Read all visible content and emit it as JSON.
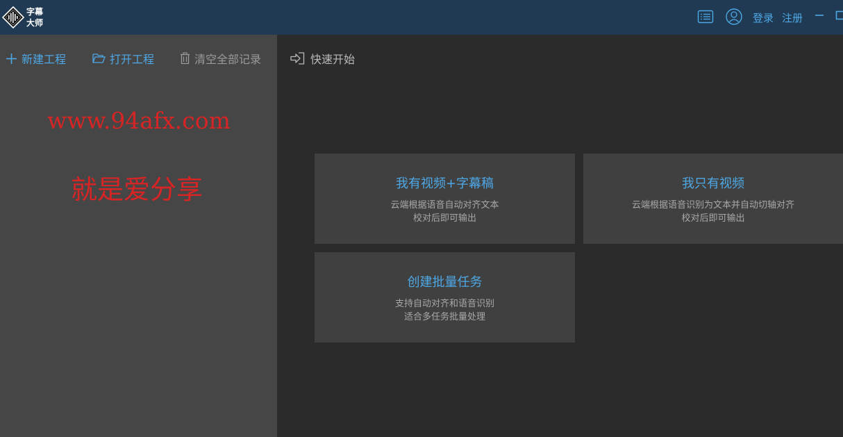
{
  "titlebar": {
    "logo_line1": "字幕",
    "logo_line2": "大师",
    "login_label": "登录",
    "register_label": "注册"
  },
  "sidebar": {
    "new_project_label": "新建工程",
    "open_project_label": "打开工程",
    "clear_records_label": "清空全部记录"
  },
  "watermark": {
    "url": "www.94afx.com",
    "slogan": "就是爱分享"
  },
  "main": {
    "quick_start_label": "快速开始",
    "cards": [
      {
        "title": "我有视频+字幕稿",
        "desc_line1": "云端根据语音自动对齐文本",
        "desc_line2": "校对后即可输出"
      },
      {
        "title": "我只有视频",
        "desc_line1": "云端根据语音识别为文本并自动切轴对齐",
        "desc_line2": "校对后即可输出"
      },
      {
        "title": "创建批量任务",
        "desc_line1": "支持自动对齐和语音识别",
        "desc_line2": "适合多任务批量处理"
      }
    ]
  },
  "colors": {
    "titlebar_bg": "#1f3a52",
    "accent_blue": "#4ea8e6",
    "sidebar_bg": "#464646",
    "main_bg": "#2b2b2b",
    "card_bg": "#404040",
    "watermark_red": "#d72424"
  }
}
